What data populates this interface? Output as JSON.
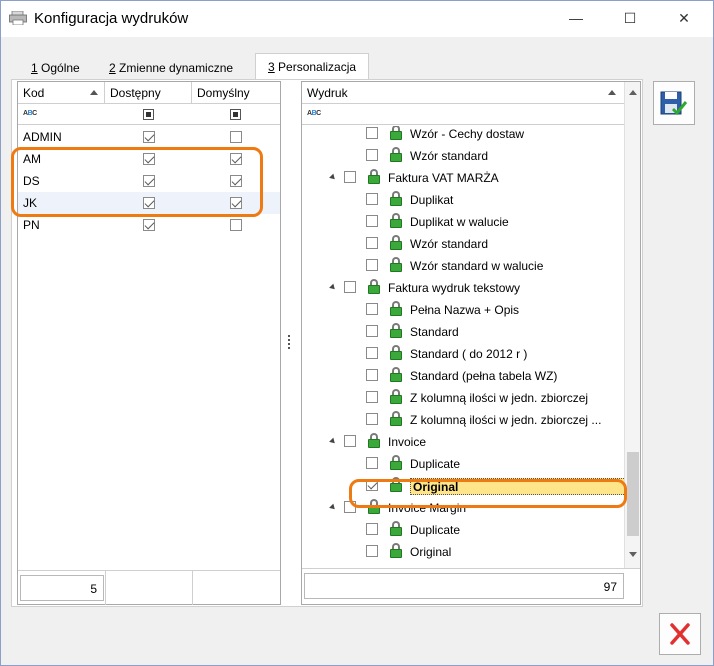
{
  "window": {
    "title": "Konfiguracja wydruków",
    "controls": {
      "minimize": "—",
      "maximize": "☐",
      "close": "✕"
    }
  },
  "tabs": [
    {
      "num": "1",
      "label": " Ogólne"
    },
    {
      "num": "2",
      "label": " Zmienne dynamiczne"
    },
    {
      "num": "3",
      "label": " Personalizacja"
    }
  ],
  "operators_grid": {
    "columns": [
      "Kod",
      "Dostępny",
      "Domyślny"
    ],
    "rows": [
      {
        "code": "ADMIN",
        "available": true,
        "default": false
      },
      {
        "code": "AM",
        "available": true,
        "default": true
      },
      {
        "code": "DS",
        "available": true,
        "default": true
      },
      {
        "code": "JK",
        "available": true,
        "default": true
      },
      {
        "code": "PN",
        "available": true,
        "default": false
      }
    ],
    "count": "5"
  },
  "printouts_tree": {
    "column": "Wydruk",
    "rows": [
      {
        "level": 2,
        "label": "Wzór - Cechy dostaw",
        "checked": false
      },
      {
        "level": 2,
        "label": "Wzór standard",
        "checked": false
      },
      {
        "level": 1,
        "label": "Faktura VAT MARŻA",
        "checked": false,
        "expanded": true
      },
      {
        "level": 2,
        "label": "Duplikat",
        "checked": false
      },
      {
        "level": 2,
        "label": "Duplikat w walucie",
        "checked": false
      },
      {
        "level": 2,
        "label": "Wzór standard",
        "checked": false
      },
      {
        "level": 2,
        "label": "Wzór standard w walucie",
        "checked": false
      },
      {
        "level": 1,
        "label": "Faktura wydruk tekstowy",
        "checked": false,
        "expanded": true
      },
      {
        "level": 2,
        "label": "Pełna Nazwa + Opis",
        "checked": false
      },
      {
        "level": 2,
        "label": "Standard",
        "checked": false
      },
      {
        "level": 2,
        "label": "Standard ( do 2012 r )",
        "checked": false
      },
      {
        "level": 2,
        "label": "Standard (pełna tabela WZ)",
        "checked": false
      },
      {
        "level": 2,
        "label": "Z kolumną ilości w jedn. zbiorczej",
        "checked": false
      },
      {
        "level": 2,
        "label": "Z kolumną ilości w jedn. zbiorczej  ...",
        "checked": false
      },
      {
        "level": 1,
        "label": "Invoice",
        "checked": false,
        "expanded": true
      },
      {
        "level": 2,
        "label": "Duplicate",
        "checked": false
      },
      {
        "level": 2,
        "label": "Original",
        "checked": true,
        "selected": true
      },
      {
        "level": 1,
        "label": "Invoice Margin",
        "checked": false,
        "expanded": true
      },
      {
        "level": 2,
        "label": "Duplicate",
        "checked": false
      },
      {
        "level": 2,
        "label": "Original",
        "checked": false
      }
    ],
    "count": "97"
  },
  "filter_icon": "abc-filter-icon",
  "colors": {
    "highlight": "#f07a12",
    "selected_row": "#ffe58a",
    "lock": "#3aa83a",
    "cancel": "#e03030"
  }
}
